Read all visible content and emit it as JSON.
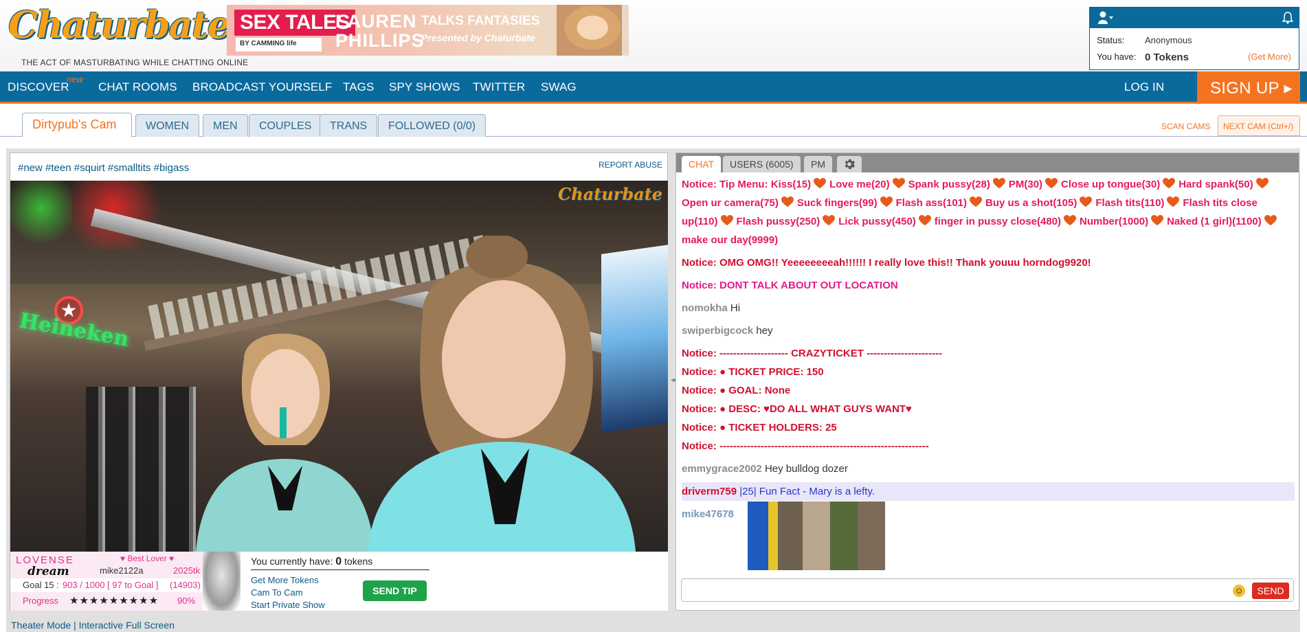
{
  "header": {
    "logo_text": "Chaturbate",
    "tagline": "THE ACT OF MASTURBATING WHILE CHATTING ONLINE",
    "banner": {
      "sex_tales": "SEX TALES",
      "by_camming": "BY CAMMING life",
      "name_line1": "LAUREN",
      "name_line2": "PHILLIPS",
      "talks": "TALKS FANTASIES",
      "presented": "Presented by Chaturbate"
    },
    "account": {
      "status_label": "Status:",
      "status_value": "Anonymous",
      "have_label": "You have:",
      "tokens_value": "0 Tokens",
      "get_more": "(Get More)"
    }
  },
  "nav": {
    "items": [
      "DISCOVER",
      "CHAT ROOMS",
      "BROADCAST YOURSELF",
      "TAGS",
      "SPY SHOWS",
      "TWITTER",
      "SWAG"
    ],
    "new_badge": "new",
    "login": "LOG IN",
    "signup": "SIGN UP ▸"
  },
  "tabs": {
    "items": [
      "Dirtypub's Cam",
      "WOMEN",
      "MEN",
      "COUPLES",
      "TRANS",
      "FOLLOWED (0/0)"
    ],
    "scan_cams": "SCAN CAMS",
    "next_cam": "NEXT CAM (Ctrl+/)"
  },
  "video": {
    "tags": "#new #teen #squirt #smalltits #bigass",
    "report_abuse": "REPORT ABUSE",
    "watermark": "Chaturbate",
    "sign_text": "Heineken",
    "lovense": {
      "logo": "LOVENSE",
      "dream": "dream",
      "best_lover": "♥ Best Lover ♥",
      "user": "mike2122a",
      "tokens": "2025tk",
      "goal_label": "Goal 15 :",
      "goal_value": "903 / 1000 [ 97 to Goal ]",
      "goal_total": "(14903)",
      "progress_label": "Progress",
      "progress_stars": "★★★★★★★★★",
      "progress_pct": "90%"
    },
    "tokens_prefix": "You currently have:",
    "tokens_count": "0",
    "tokens_suffix": "tokens",
    "links": [
      "Get More Tokens",
      "Cam To Cam",
      "Start Private Show"
    ],
    "send_tip": "SEND TIP"
  },
  "below": {
    "theater": "Theater Mode",
    "sep": "|",
    "fullscreen": "Interactive Full Screen"
  },
  "chat": {
    "tabs": [
      "CHAT",
      "USERS (6005)",
      "PM"
    ],
    "tip_menu_prefix": "Notice: Tip Menu:",
    "tip_items": [
      "Kiss(15)",
      "Love me(20)",
      "Spank pussy(28)",
      "PM(30)",
      "Close up tongue(30)",
      "Hard spank(50)",
      "Open ur camera(75)",
      "Suck fingers(99)",
      "Flash ass(101)",
      "Buy us a shot(105)",
      "Flash tits(110)",
      "Flash tits close up(110)",
      "Flash pussy(250)",
      "Lick pussy(450)",
      "finger in pussy close(480)",
      "Number(1000)",
      "Naked (1 girl)(1100)",
      "make our day(9999)"
    ],
    "notice_omg": "Notice: OMG OMG!! Yeeeeeeeeah!!!!!! I really love this!! Thank youuu horndog9920!",
    "notice_location": "Notice: DONT TALK ABOUT OUT LOCATION",
    "m1_user": "nomokha",
    "m1_text": "Hi",
    "m2_user": "swiperbigcock",
    "m2_text": "hey",
    "ticket": [
      "Notice: -------------------- CRAZYTICKET ----------------------",
      "Notice: ● TICKET PRICE:   150",
      "Notice: ● GOAL:   None",
      "Notice: ● DESC:   ♥DO ALL WHAT GUYS WANT♥",
      "Notice: ● TICKET HOLDERS:   25",
      "Notice: -------------------------------------------------------------"
    ],
    "m3_user": "emmygrace2002",
    "m3_text": "Hey bulldog dozer",
    "m4_user": "driverm759",
    "m4_text": "|25| Fun Fact - Mary is a lefty.",
    "m5_user": "mike47678",
    "send": "SEND",
    "emoji": "☺"
  },
  "colors": {
    "nav_blue": "#0a6a9c",
    "accent_orange": "#f47321",
    "notice_red": "#d10f2f",
    "notice_pink": "#e41a8a"
  }
}
